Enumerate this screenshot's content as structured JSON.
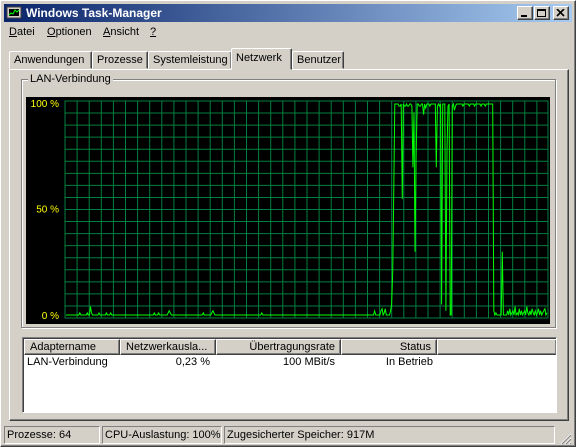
{
  "window": {
    "title": "Windows Task-Manager"
  },
  "menu": [
    {
      "label": "Datei",
      "key": "D",
      "rest": "atei"
    },
    {
      "label": "Optionen",
      "key": "O",
      "rest": "ptionen"
    },
    {
      "label": "Ansicht",
      "key": "A",
      "rest": "nsicht"
    },
    {
      "label": "?",
      "key": "?",
      "rest": ""
    }
  ],
  "tabs": [
    {
      "label": "Anwendungen",
      "active": false
    },
    {
      "label": "Prozesse",
      "active": false
    },
    {
      "label": "Systemleistung",
      "active": false
    },
    {
      "label": "Netzwerk",
      "active": true
    },
    {
      "label": "Benutzer",
      "active": false
    }
  ],
  "graph": {
    "group_label": "LAN-Verbindung",
    "y_labels": [
      "100 %",
      "50 %",
      "0 %"
    ],
    "grid_color": "#008040",
    "line_color": "#00ff00",
    "label_color": "#ffff00",
    "background": "#000000"
  },
  "chart_data": {
    "type": "line",
    "title": "LAN-Verbindung",
    "ylim": [
      0,
      100
    ],
    "ytick_labels": [
      "100 %",
      "50 %",
      "0 %"
    ],
    "grid": true,
    "series": [
      {
        "name": "LAN-Verbindung",
        "values": [
          0,
          0,
          0,
          0,
          0,
          0,
          0,
          0,
          0,
          0,
          0,
          0,
          0,
          1,
          0,
          0,
          0,
          0,
          0,
          0,
          1,
          0,
          0,
          4,
          1,
          0,
          0,
          0,
          0,
          0,
          0,
          1,
          0,
          0,
          0,
          0,
          0,
          0,
          1,
          0,
          0,
          0,
          1,
          0,
          0,
          0,
          0,
          0,
          0,
          0,
          0,
          0,
          0,
          0,
          0,
          0,
          0,
          0,
          0,
          0,
          0,
          0,
          0,
          0,
          0,
          0,
          0,
          0,
          0,
          0,
          0,
          0,
          0,
          0,
          0,
          0,
          0,
          0,
          0,
          0,
          0,
          0,
          0,
          1,
          0,
          0,
          0,
          1,
          0,
          0,
          0,
          0,
          0,
          0,
          0,
          0,
          1,
          2,
          1,
          0,
          0,
          0,
          0,
          0,
          0,
          0,
          0,
          0,
          0,
          0,
          0,
          0,
          0,
          0,
          0,
          0,
          0,
          0,
          0,
          0,
          0,
          0,
          0,
          0,
          0,
          0,
          0,
          0,
          0,
          1,
          0,
          0,
          0,
          0,
          0,
          0,
          0,
          1,
          2,
          1,
          0,
          0,
          0,
          0,
          0,
          0,
          0,
          0,
          0,
          0,
          0,
          0,
          0,
          0,
          0,
          0,
          0,
          0,
          0,
          0,
          0,
          0,
          0,
          0,
          0,
          0,
          0,
          0,
          0,
          0,
          0,
          0,
          0,
          0,
          0,
          0,
          0,
          0,
          0,
          0,
          0,
          0,
          0,
          0,
          1,
          0,
          0,
          0,
          0,
          0,
          0,
          0,
          0,
          0,
          0,
          0,
          0,
          0,
          0,
          0,
          0,
          0,
          0,
          0,
          0,
          0,
          0,
          0,
          0,
          0,
          0,
          0,
          0,
          0,
          0,
          0,
          0,
          0,
          0,
          0,
          0,
          0,
          0,
          0,
          0,
          0,
          0,
          0,
          0,
          0,
          0,
          0,
          0,
          0,
          0,
          0,
          0,
          0,
          0,
          0,
          0,
          0,
          0,
          0,
          0,
          0,
          0,
          0,
          0,
          0,
          0,
          0,
          0,
          0,
          0,
          0,
          0,
          0,
          0,
          0,
          0,
          0,
          0,
          0,
          0,
          0,
          0,
          0,
          0,
          0,
          0,
          0,
          0,
          0,
          0,
          0,
          0,
          0,
          0,
          0,
          0,
          0,
          0,
          0,
          0,
          0,
          0,
          0,
          0,
          0,
          2,
          0,
          0,
          0,
          0,
          0,
          2,
          3,
          0,
          1,
          3,
          0,
          0,
          0,
          0,
          2,
          5,
          20,
          60,
          100,
          100,
          100,
          100,
          99,
          99,
          100,
          55,
          100,
          99,
          99,
          100,
          99,
          99,
          100,
          100,
          99,
          70,
          96,
          30,
          75,
          100,
          100,
          99,
          99,
          100,
          100,
          95,
          100,
          98,
          100,
          100,
          100,
          99,
          100,
          100,
          100,
          100,
          100,
          70,
          99,
          100,
          99,
          100,
          5,
          100,
          100,
          100,
          2,
          78,
          99,
          100,
          0,
          0,
          99,
          100,
          97,
          99,
          100,
          100,
          100,
          100,
          100,
          100,
          99,
          100,
          100,
          100,
          100,
          100,
          99,
          100,
          100,
          100,
          100,
          99,
          100,
          100,
          100,
          100,
          100,
          99,
          100,
          100,
          100,
          99,
          100,
          100,
          100,
          100,
          100,
          100,
          100,
          2,
          0,
          1,
          0,
          0,
          0,
          0,
          0,
          30,
          0,
          0,
          0,
          0,
          2,
          0,
          3,
          0,
          1,
          2,
          0,
          4,
          0,
          1,
          0,
          3,
          0,
          2,
          0,
          1,
          2,
          0,
          4,
          1,
          0,
          2,
          0,
          3,
          1,
          0,
          2,
          0,
          1,
          3,
          0,
          2,
          0,
          1,
          2,
          3,
          0,
          1
        ]
      }
    ]
  },
  "adapter_table": {
    "columns": [
      "Adaptername",
      "Netzwerkausla...",
      "Übertragungsrate",
      "Status"
    ],
    "rows": [
      {
        "name": "LAN-Verbindung",
        "utilization": "0,23 %",
        "speed": "100 MBit/s",
        "status": "In Betrieb"
      }
    ]
  },
  "statusbar": {
    "processes": "Prozesse: 64",
    "cpu": "CPU-Auslastung: 100%",
    "memory": "Zugesicherter Speicher: 917M"
  }
}
